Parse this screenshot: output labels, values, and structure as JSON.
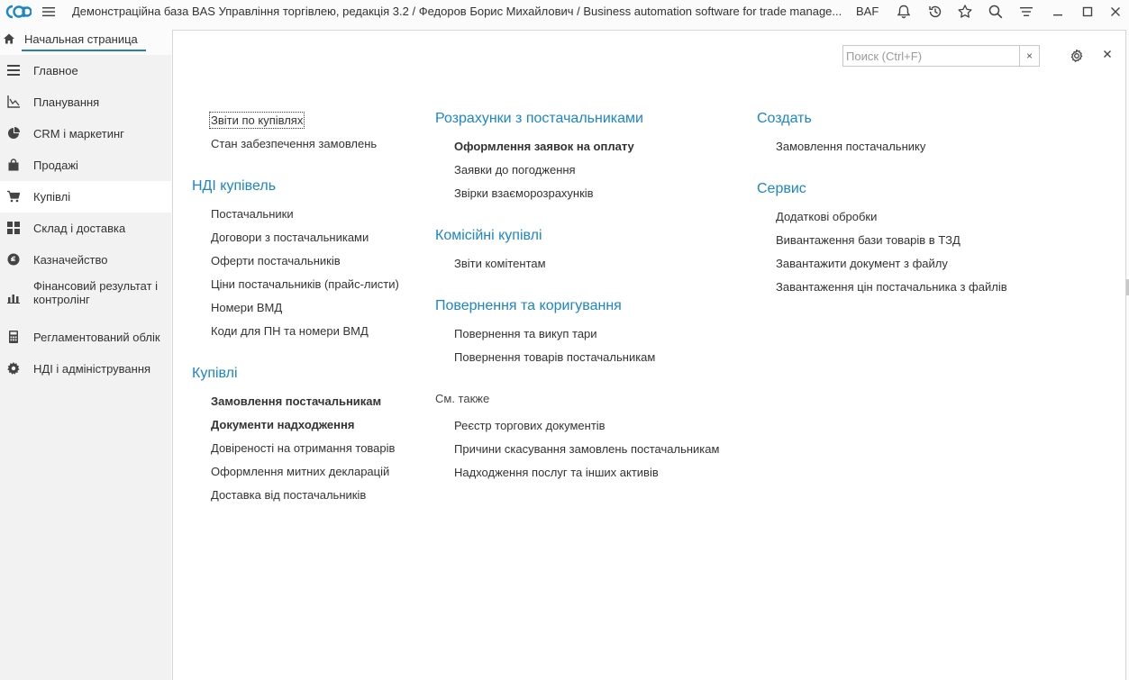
{
  "titlebar": {
    "title": "Демонстраційна база BAS Управління торгівлею, редакція 3.2 / Федоров Борис Михайлович / Business automation software for trade manage...",
    "brand": "BAF"
  },
  "home_tab": {
    "label": "Начальная страница"
  },
  "sidebar": {
    "items": [
      {
        "label": "Главное"
      },
      {
        "label": "Планування"
      },
      {
        "label": "CRM і маркетинг"
      },
      {
        "label": "Продажі"
      },
      {
        "label": "Купівлі"
      },
      {
        "label": "Склад і доставка"
      },
      {
        "label": "Казначейство"
      },
      {
        "label": "Фінансовий результат і контролінг"
      },
      {
        "label": "Регламентований облік"
      },
      {
        "label": "НДІ і адміністрування"
      }
    ]
  },
  "search": {
    "placeholder": "Поиск (Ctrl+F)",
    "clear": "×"
  },
  "close_symbol": "×",
  "col1": {
    "top_links": [
      "Звіти по купівлях",
      "Стан забезпечення замовлень"
    ],
    "ndi_header": "НДІ купівель",
    "ndi_links": [
      "Постачальники",
      "Договори з постачальниками",
      "Оферти постачальників",
      "Ціни постачальників (прайс-листи)",
      "Номери ВМД",
      "Коди для ПН та номери ВМД"
    ],
    "purchases_header": "Купівлі",
    "purchases_links": [
      "Замовлення постачальникам",
      "Документи надходження",
      "Довіреності на отримання товарів",
      "Оформлення митних декларацій",
      "Доставка від постачальників"
    ]
  },
  "col2": {
    "settlements_header": "Розрахунки з постачальниками",
    "settlements_links": [
      "Оформлення заявок на оплату",
      "Заявки до погодження",
      "Звірки взаєморозрахунків"
    ],
    "commission_header": "Комісійні купівлі",
    "commission_links": [
      "Звіти комітентам"
    ],
    "returns_header": "Повернення та коригування",
    "returns_links": [
      "Повернення та викуп тари",
      "Повернення товарів постачальникам"
    ],
    "see_also_header": "См. также",
    "see_also_links": [
      "Реєстр торгових документів",
      "Причини скасування замовлень постачальникам",
      "Надходження послуг та інших активів"
    ]
  },
  "col3": {
    "create_header": "Создать",
    "create_links": [
      "Замовлення постачальнику"
    ],
    "service_header": "Сервис",
    "service_links": [
      "Додаткові обробки",
      "Вивантаження бази товарів в ТЗД",
      "Завантажити документ з файлу",
      "Завантаження цін постачальника з файлів"
    ]
  }
}
